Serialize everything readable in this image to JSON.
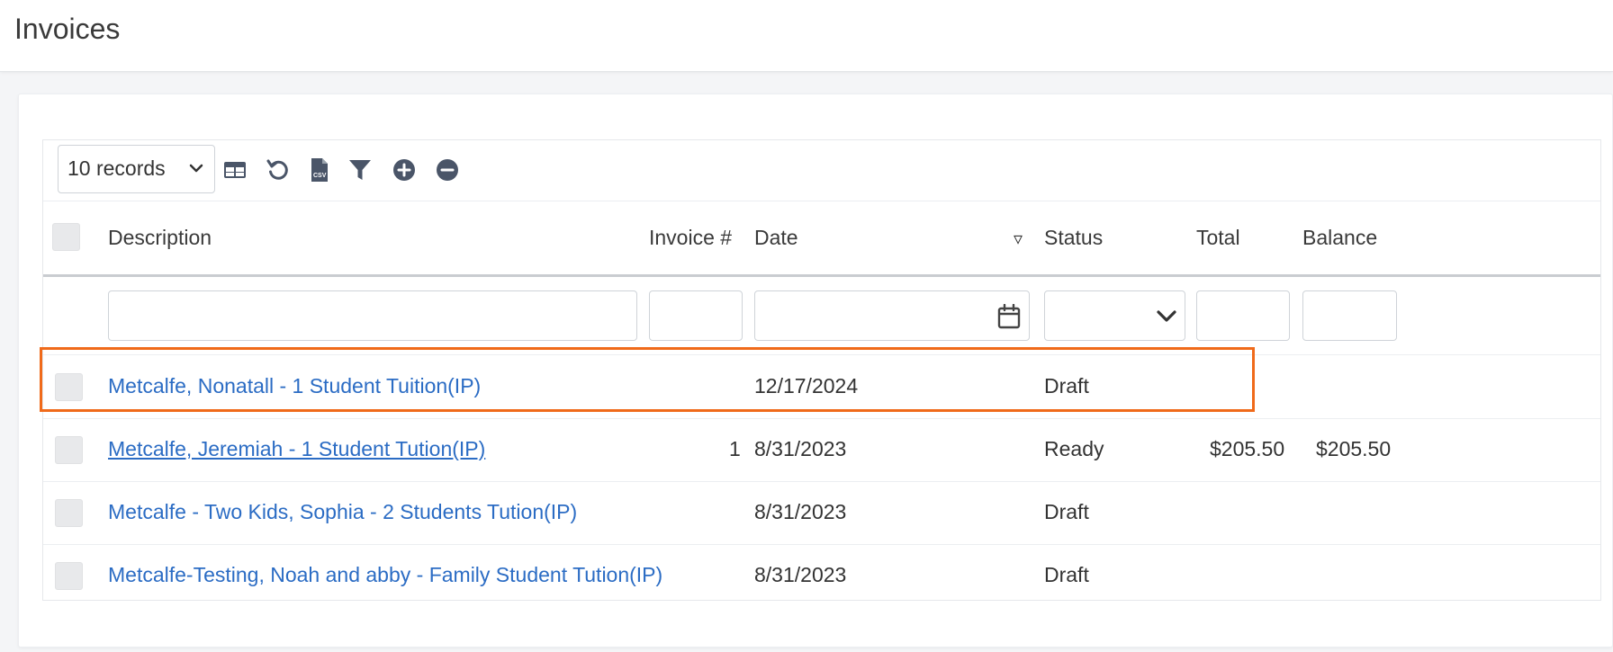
{
  "page": {
    "title": "Invoices"
  },
  "toolbar": {
    "records_select": "10 records",
    "icons": [
      "table-icon",
      "refresh-icon",
      "csv-icon",
      "filter-icon",
      "plus-circle-icon",
      "minus-circle-icon"
    ]
  },
  "table": {
    "columns": [
      "Description",
      "Invoice #",
      "Date",
      "Status",
      "Total",
      "Balance"
    ],
    "sort_indicator": "▿",
    "rows": [
      {
        "description": "Metcalfe, Nonatall - 1 Student Tuition(IP)",
        "invoice": "",
        "date": "12/17/2024",
        "status": "Draft",
        "total": "",
        "balance": ""
      },
      {
        "description": "Metcalfe, Jeremiah - 1 Student Tution(IP)",
        "invoice": "1",
        "date": "8/31/2023",
        "status": "Ready",
        "total": "$205.50",
        "balance": "$205.50"
      },
      {
        "description": "Metcalfe - Two Kids, Sophia - 2 Students Tution(IP)",
        "invoice": "",
        "date": "8/31/2023",
        "status": "Draft",
        "total": "",
        "balance": ""
      },
      {
        "description": "Metcalfe-Testing, Noah and abby - Family Student Tution(IP)",
        "invoice": "",
        "date": "8/31/2023",
        "status": "Draft",
        "total": "",
        "balance": ""
      }
    ]
  },
  "colors": {
    "link": "#2b6cc4",
    "highlight": "#f06a1a"
  }
}
